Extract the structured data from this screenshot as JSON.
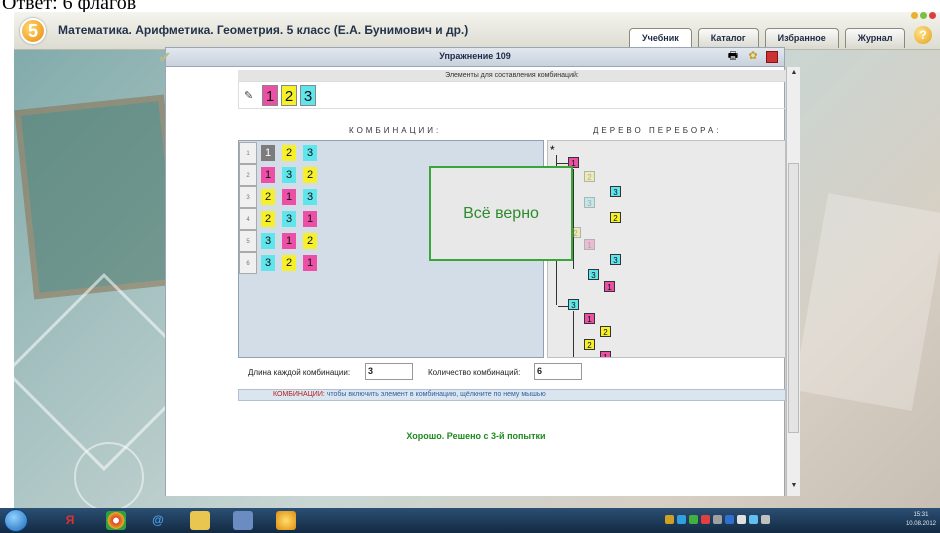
{
  "caption": {
    "text": "Ответ: 6 флагов"
  },
  "app": {
    "title": "Математика. Арифметика. Геометрия. 5 класс (Е.А. Бунимович и др.)",
    "logo_text": "5",
    "help_label": "?",
    "tabs": [
      {
        "label": "Учебник",
        "active": true
      },
      {
        "label": "Каталог",
        "active": false
      },
      {
        "label": "Избранное",
        "active": false
      },
      {
        "label": "Журнал",
        "active": false
      }
    ]
  },
  "exercise": {
    "title": "Упражнение 109",
    "elements_label": "Элементы для составления комбинаций:",
    "elements": [
      "1",
      "2",
      "3"
    ],
    "combos_heading": "КОМБИНАЦИИ:",
    "tree_heading": "ДЕРЕВО ПЕРЕБОРА:",
    "tree_root": "*",
    "combinations": [
      {
        "num": "1",
        "items": [
          "1",
          "2",
          "3"
        ]
      },
      {
        "num": "2",
        "items": [
          "1",
          "3",
          "2"
        ]
      },
      {
        "num": "3",
        "items": [
          "2",
          "1",
          "3"
        ]
      },
      {
        "num": "4",
        "items": [
          "2",
          "3",
          "1"
        ]
      },
      {
        "num": "5",
        "items": [
          "3",
          "1",
          "2"
        ]
      },
      {
        "num": "6",
        "items": [
          "3",
          "2",
          "1"
        ]
      }
    ],
    "popup_text": "Всё верно",
    "length_label": "Длина каждой комбинации:",
    "length_value": "3",
    "count_label": "Количество комбинаций:",
    "count_value": "6",
    "hint_key": "КОМБИНАЦИИ:",
    "hint_text": " чтобы включить элемент в комбинацию, щёлкните по нему мышью",
    "result_text": "Хорошо. Решено с 3-й попытки"
  },
  "colors": {
    "tile_1": "#ee4fa6",
    "tile_2": "#f6f02a",
    "tile_3": "#5fe5ec",
    "tile_selected": "#7c7c7c",
    "success": "#2d8a2d"
  },
  "taskbar": {
    "clock_time": "15:31",
    "clock_date": "10.08.2012"
  }
}
